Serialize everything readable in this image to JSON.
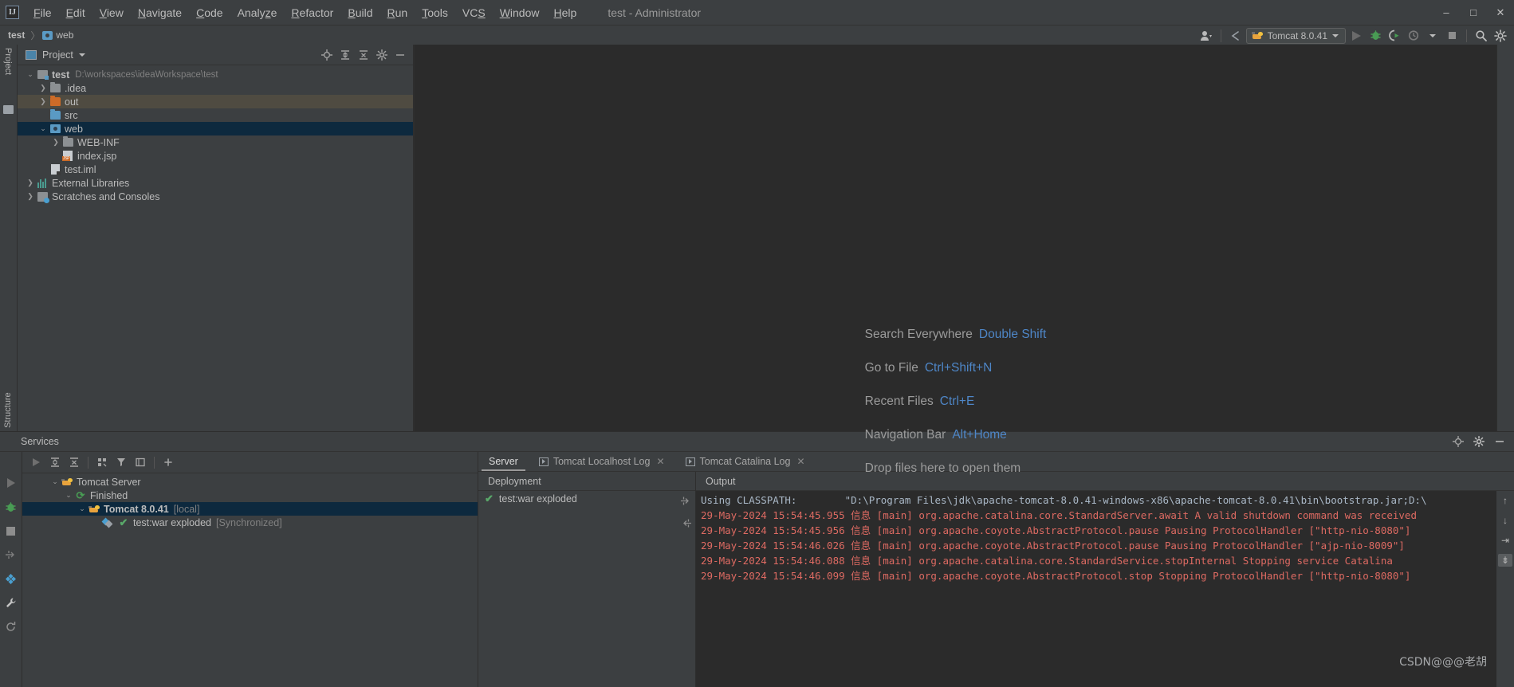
{
  "window": {
    "title": "test - Administrator",
    "logo": "IJ",
    "minimize": "–",
    "maximize": "□",
    "close": "✕"
  },
  "menubar": {
    "items": [
      {
        "label": "File",
        "mnemonic": "F"
      },
      {
        "label": "Edit",
        "mnemonic": "E"
      },
      {
        "label": "View",
        "mnemonic": "V"
      },
      {
        "label": "Navigate",
        "mnemonic": "N"
      },
      {
        "label": "Code",
        "mnemonic": "C"
      },
      {
        "label": "Analyze",
        "mnemonic": "z"
      },
      {
        "label": "Refactor",
        "mnemonic": "R"
      },
      {
        "label": "Build",
        "mnemonic": "B"
      },
      {
        "label": "Run",
        "mnemonic": "R"
      },
      {
        "label": "Tools",
        "mnemonic": "T"
      },
      {
        "label": "VCS",
        "mnemonic": "S"
      },
      {
        "label": "Window",
        "mnemonic": "W"
      },
      {
        "label": "Help",
        "mnemonic": "H"
      }
    ]
  },
  "navbar": {
    "crumb_project": "test",
    "crumb_separator": "〉",
    "crumb_folder": "web",
    "run_config": "Tomcat 8.0.41",
    "icons": {
      "user": "user-icon",
      "back": "back-arrow-icon",
      "run": "run-icon",
      "debug": "debug-icon",
      "run_with_coverage": "run-with-coverage-icon",
      "profile": "profile-icon",
      "stop": "stop-icon",
      "search": "search-icon",
      "settings": "settings-icon"
    }
  },
  "left_strip": {
    "top_label": "Project",
    "bottom_label": "Structure"
  },
  "project_pane": {
    "title": "Project",
    "tools": [
      "locate-icon",
      "expand-all-icon",
      "collapse-all-icon",
      "settings-icon",
      "hide-icon"
    ],
    "tree": [
      {
        "label": "test",
        "path": "D:\\workspaces\\ideaWorkspace\\test",
        "indent": 0,
        "arrow": "v",
        "icon": "project-root",
        "bold": true,
        "state": "normal"
      },
      {
        "label": ".idea",
        "path": "",
        "indent": 1,
        "arrow": ">",
        "icon": "folder-gray",
        "bold": false,
        "state": "normal"
      },
      {
        "label": "out",
        "path": "",
        "indent": 1,
        "arrow": ">",
        "icon": "folder-orange",
        "bold": false,
        "state": "highlight"
      },
      {
        "label": "src",
        "path": "",
        "indent": 1,
        "arrow": "",
        "icon": "folder-blue",
        "bold": false,
        "state": "normal"
      },
      {
        "label": "web",
        "path": "",
        "indent": 1,
        "arrow": "v",
        "icon": "folder-module",
        "bold": false,
        "state": "selected"
      },
      {
        "label": "WEB-INF",
        "path": "",
        "indent": 2,
        "arrow": ">",
        "icon": "folder-gray",
        "bold": false,
        "state": "normal"
      },
      {
        "label": "index.jsp",
        "path": "",
        "indent": 2,
        "arrow": "",
        "icon": "jsp-file",
        "bold": false,
        "state": "normal"
      },
      {
        "label": "test.iml",
        "path": "",
        "indent": 1,
        "arrow": "",
        "icon": "iml-file",
        "bold": false,
        "state": "normal"
      },
      {
        "label": "External Libraries",
        "path": "",
        "indent": 0,
        "arrow": ">",
        "icon": "libraries",
        "bold": false,
        "state": "normal"
      },
      {
        "label": "Scratches and Consoles",
        "path": "",
        "indent": 0,
        "arrow": ">",
        "icon": "scratches",
        "bold": false,
        "state": "normal"
      }
    ]
  },
  "editor": {
    "hints": [
      {
        "action": "Search Everywhere",
        "shortcut": "Double Shift"
      },
      {
        "action": "Go to File",
        "shortcut": "Ctrl+Shift+N"
      },
      {
        "action": "Recent Files",
        "shortcut": "Ctrl+E"
      },
      {
        "action": "Navigation Bar",
        "shortcut": "Alt+Home"
      },
      {
        "action": "Drop files here to open them",
        "shortcut": ""
      }
    ],
    "annotation": {
      "type": "red-arrow",
      "points_to": "run-button",
      "color": "#FF0000"
    }
  },
  "services": {
    "title": "Services",
    "header_tools": [
      "locate-icon",
      "settings-icon",
      "hide-icon"
    ],
    "side_icons": [
      "run-icon",
      "debug-icon",
      "stop-icon",
      "jump-to-source-icon",
      "deploy-icon",
      "wrench-icon",
      "restart-icon"
    ],
    "toolbar_icons": [
      "run-icon",
      "expand-all-icon",
      "collapse-all-icon",
      "group-icon",
      "filter-icon",
      "open-in-editor-icon",
      "add-icon"
    ],
    "tree": [
      {
        "label": "Tomcat Server",
        "suffix": "",
        "indent": 0,
        "arrow": "v",
        "icon": "tomcat-icon",
        "state": "normal",
        "bold": false
      },
      {
        "label": "Finished",
        "suffix": "",
        "indent": 1,
        "arrow": "v",
        "icon": "finished-icon",
        "state": "normal",
        "bold": false
      },
      {
        "label": "Tomcat 8.0.41",
        "suffix": "[local]",
        "indent": 2,
        "arrow": "v",
        "icon": "tomcat-icon",
        "state": "selected",
        "bold": true
      },
      {
        "label": "test:war exploded",
        "suffix": "[Synchronized]",
        "indent": 3,
        "arrow": "",
        "icon": "artifact-icon",
        "state": "normal",
        "bold": false
      }
    ],
    "tabs": [
      {
        "label": "Server",
        "active": true,
        "closable": false,
        "icon": ""
      },
      {
        "label": "Tomcat Localhost Log",
        "active": false,
        "closable": true,
        "icon": "console-icon"
      },
      {
        "label": "Tomcat Catalina Log",
        "active": false,
        "closable": true,
        "icon": "console-icon"
      }
    ],
    "deployment": {
      "caption": "Deployment",
      "items": [
        {
          "label": "test:war exploded",
          "status": "ok"
        }
      ],
      "side_icons": [
        "jump-to-source-icon",
        "sync-icon"
      ]
    },
    "output": {
      "caption": "Output",
      "lines": [
        {
          "type": "gray",
          "text": "Using CLASSPATH:        \"D:\\Program Files\\jdk\\apache-tomcat-8.0.41-windows-x86\\apache-tomcat-8.0.41\\bin\\bootstrap.jar;D:\\"
        },
        {
          "type": "red",
          "text": "29-May-2024 15:54:45.955 信息 [main] org.apache.catalina.core.StandardServer.await A valid shutdown command was received"
        },
        {
          "type": "red",
          "text": "29-May-2024 15:54:45.956 信息 [main] org.apache.coyote.AbstractProtocol.pause Pausing ProtocolHandler [\"http-nio-8080\"]"
        },
        {
          "type": "red",
          "text": "29-May-2024 15:54:46.026 信息 [main] org.apache.coyote.AbstractProtocol.pause Pausing ProtocolHandler [\"ajp-nio-8009\"]"
        },
        {
          "type": "red",
          "text": "29-May-2024 15:54:46.088 信息 [main] org.apache.catalina.core.StandardService.stopInternal Stopping service Catalina"
        },
        {
          "type": "red",
          "text": "29-May-2024 15:54:46.099 信息 [main] org.apache.coyote.AbstractProtocol.stop Stopping ProtocolHandler [\"http-nio-8080\"]"
        }
      ],
      "scroll_icons": [
        "scroll-up-icon",
        "scroll-down-icon",
        "soft-wrap-icon",
        "scroll-to-end-icon"
      ]
    },
    "watermark": "CSDN@@@老胡"
  }
}
